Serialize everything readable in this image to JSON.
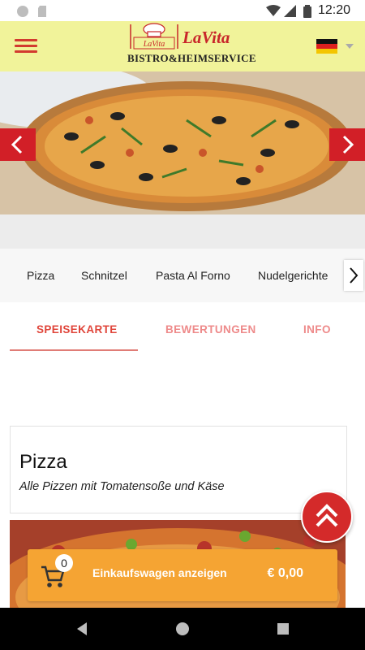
{
  "status_bar": {
    "time": "12:20"
  },
  "header": {
    "brand_name": "LaVita",
    "brand_sub": "BISTRO&HEIMSERVICE",
    "logo_script": "LaVita",
    "language_flag": "de"
  },
  "categories": [
    "Pizza",
    "Schnitzel",
    "Pasta Al Forno",
    "Nudelgerichte"
  ],
  "tabs": [
    "SPEISEKARTE",
    "BEWERTUNGEN",
    "INFO"
  ],
  "section": {
    "title": "Pizza",
    "subtitle": "Alle Pizzen mit Tomatensoße und Käse"
  },
  "cart": {
    "count": "0",
    "label": "Einkaufswagen anzeigen",
    "total": "€ 0,00"
  },
  "colors": {
    "header_bg": "#f1f39a",
    "accent_red": "#d21f27",
    "cart_orange": "#f5a433",
    "tab_active": "#e0453a"
  }
}
